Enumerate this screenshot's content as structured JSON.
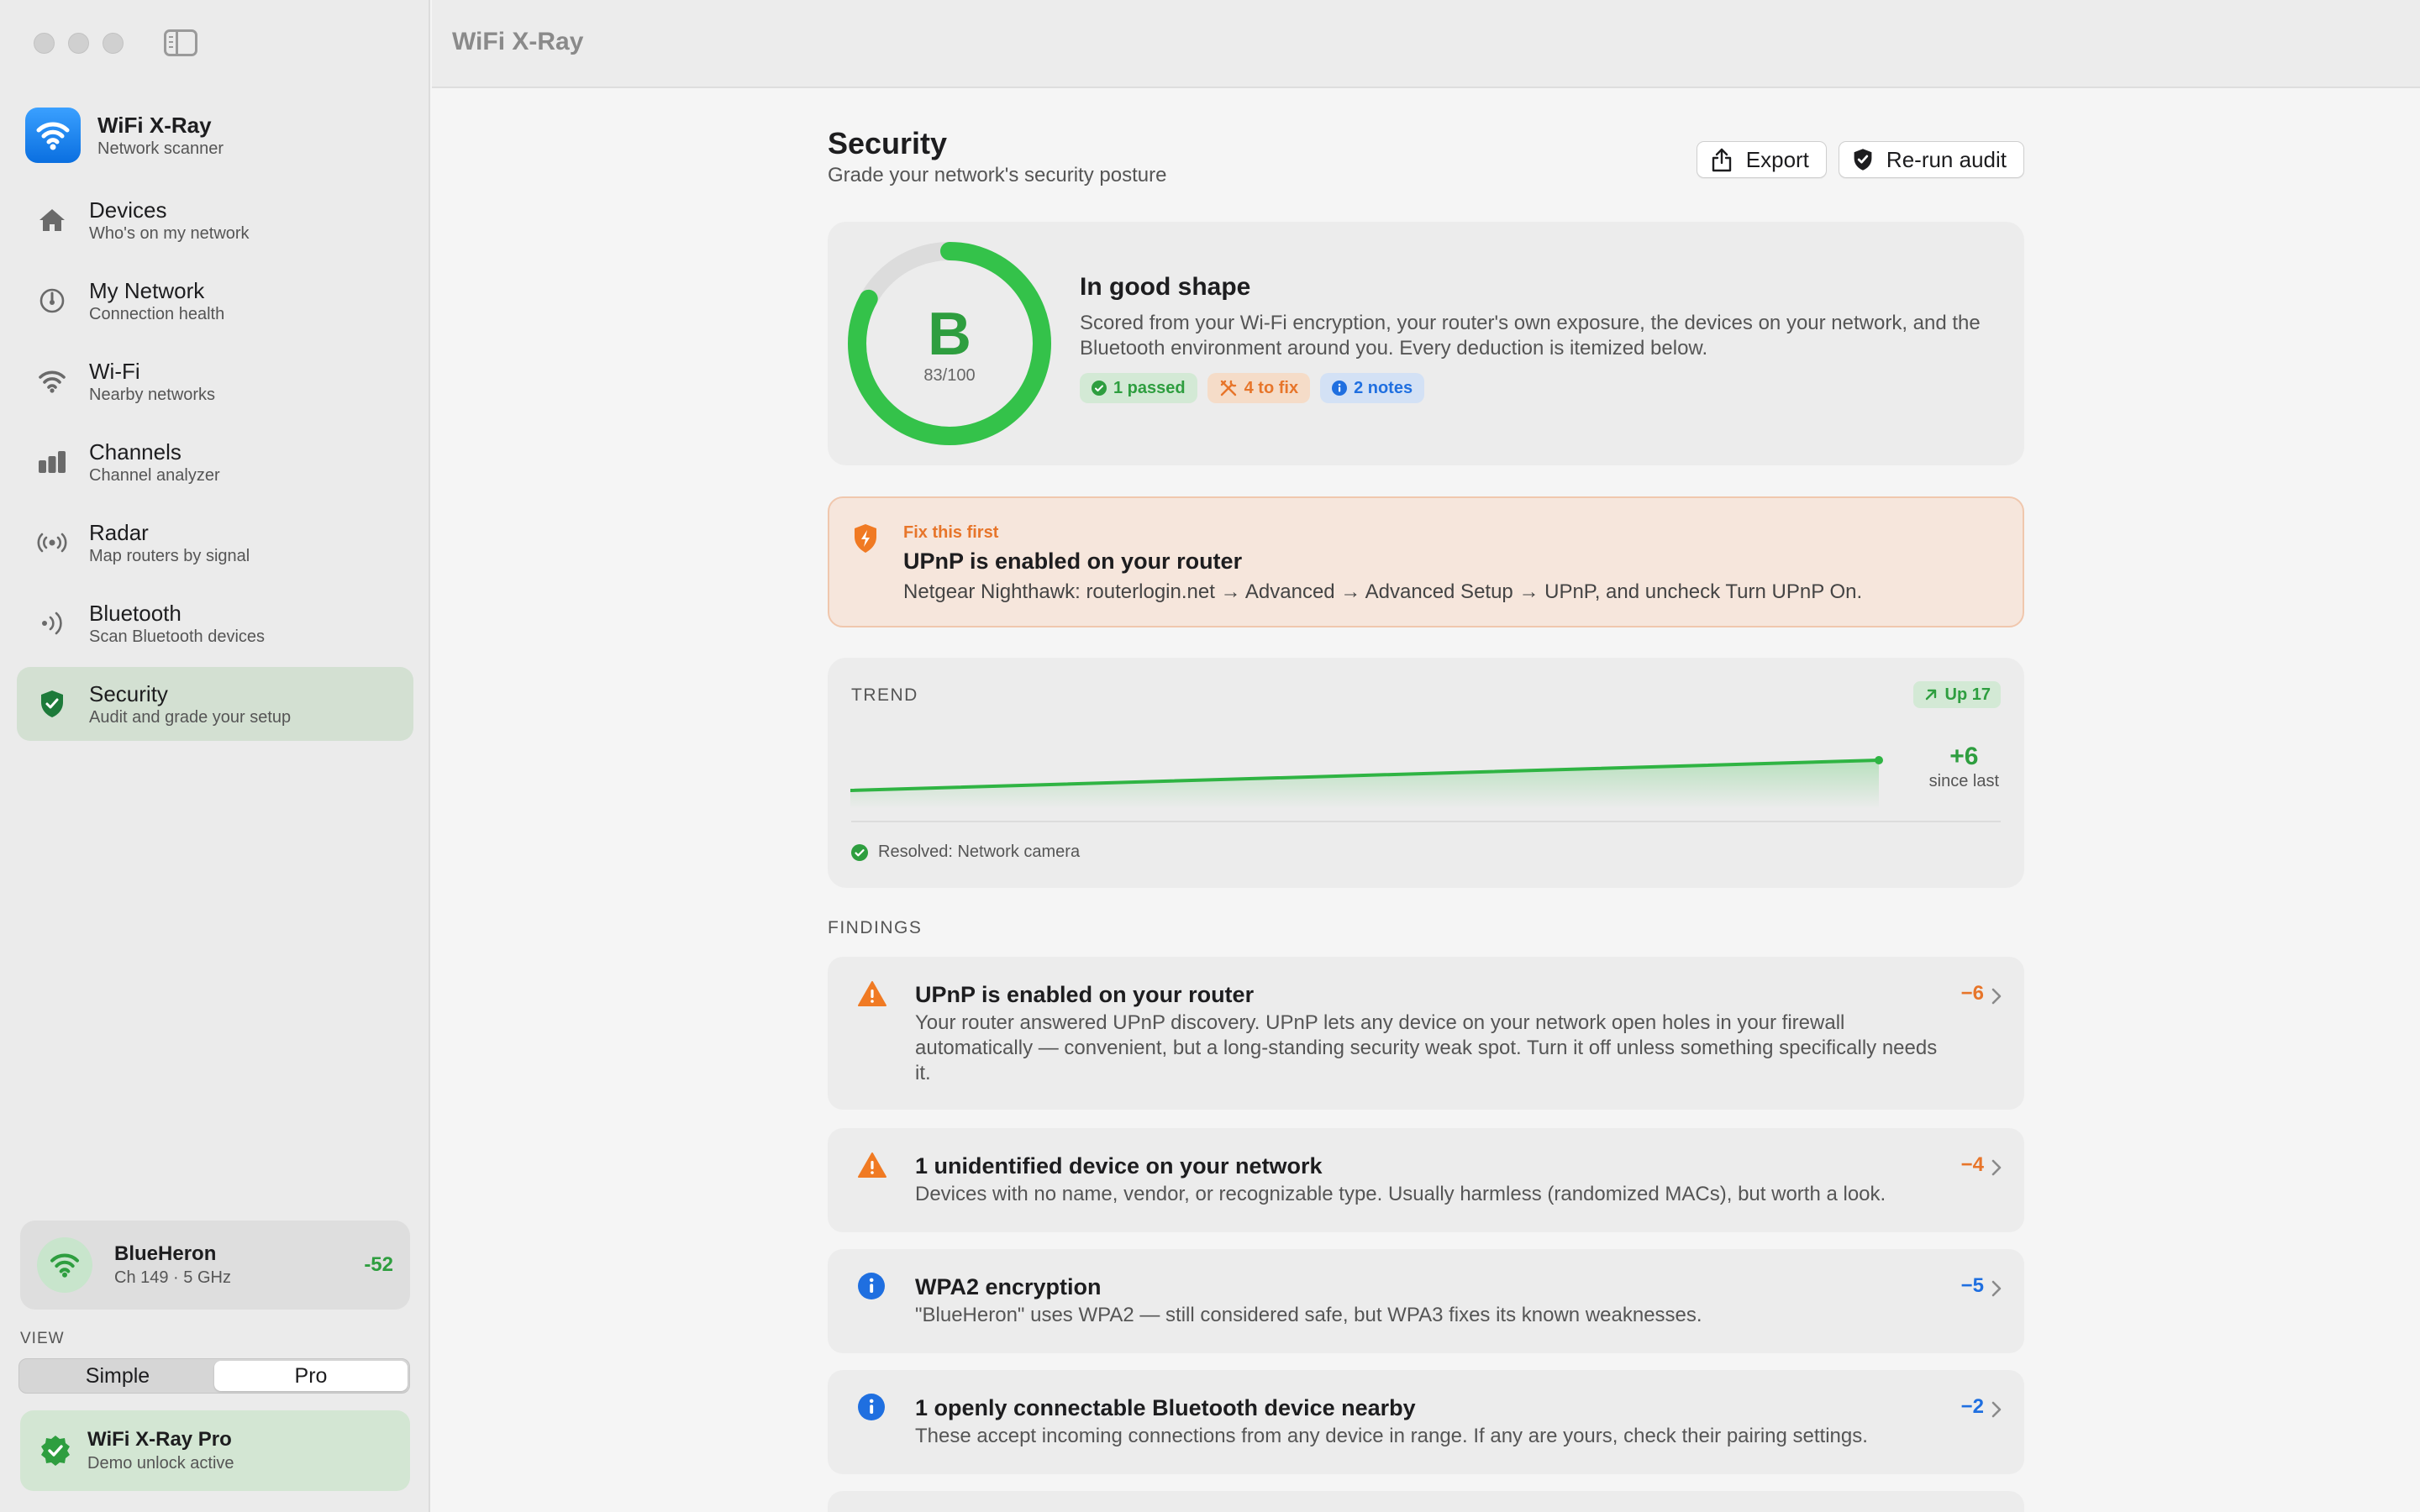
{
  "app": {
    "title": "WiFi X-Ray",
    "subtitle": "Network scanner"
  },
  "colors": {
    "accent": "#2e9e3f",
    "warning": "#e7752a",
    "info": "#1f6fe0",
    "active_nav_bg": "#d3e0d2"
  },
  "sidebar": {
    "items": [
      {
        "label": "Devices",
        "sub": "Who's on my network",
        "icon": "house-icon"
      },
      {
        "label": "My Network",
        "sub": "Connection health",
        "icon": "gauge-icon"
      },
      {
        "label": "Wi-Fi",
        "sub": "Nearby networks",
        "icon": "wifi-icon"
      },
      {
        "label": "Channels",
        "sub": "Channel analyzer",
        "icon": "bar-chart-icon"
      },
      {
        "label": "Radar",
        "sub": "Map routers by signal",
        "icon": "radar-icon"
      },
      {
        "label": "Bluetooth",
        "sub": "Scan Bluetooth devices",
        "icon": "bluetooth-waves-icon"
      },
      {
        "label": "Security",
        "sub": "Audit and grade your setup",
        "icon": "shield-check-icon",
        "active": true
      }
    ],
    "network": {
      "name": "BlueHeron",
      "details": "Ch 149 · 5 GHz",
      "rssi": "-52"
    },
    "view_label": "VIEW",
    "view_options": [
      "Simple",
      "Pro"
    ],
    "view_selected": "Pro",
    "pro": {
      "title": "WiFi X-Ray Pro",
      "sub": "Demo unlock active"
    }
  },
  "page": {
    "title": "Security",
    "subtitle": "Grade your network's security posture",
    "export_label": "Export",
    "rerun_label": "Re-run audit"
  },
  "score": {
    "grade": "B",
    "value_text": "83/100",
    "fraction": 0.83,
    "title": "In good shape",
    "description": "Scored from your Wi-Fi encryption, your router's own exposure, the devices on your network, and the Bluetooth environment around you. Every deduction is itemized below.",
    "passed": "1 passed",
    "to_fix": "4 to fix",
    "notes": "2 notes"
  },
  "fix_first": {
    "kicker": "Fix this first",
    "title": "UPnP is enabled on your router",
    "description": "Netgear Nighthawk: routerlogin.net → Advanced → Advanced Setup → UPnP, and uncheck Turn UPnP On."
  },
  "trend": {
    "label": "TREND",
    "badge": "Up 17",
    "delta": "+6",
    "delta_label": "since last",
    "resolved": "Resolved: Network camera"
  },
  "findings_label": "FINDINGS",
  "findings": [
    {
      "title": "UPnP is enabled on your router",
      "description": "Your router answered UPnP discovery. UPnP lets any device on your network open holes in your firewall automatically — convenient, but a long-standing security weak spot. Turn it off unless something specifically needs it.",
      "score": "−6",
      "severity": "warning"
    },
    {
      "title": "1 unidentified device on your network",
      "description": "Devices with no name, vendor, or recognizable type. Usually harmless (randomized MACs), but worth a look.",
      "score": "−4",
      "severity": "warning"
    },
    {
      "title": "WPA2 encryption",
      "description": "\"BlueHeron\" uses WPA2 — still considered safe, but WPA3 fixes its known weaknesses.",
      "score": "−5",
      "severity": "info"
    },
    {
      "title": "1 openly connectable Bluetooth device nearby",
      "description": "These accept incoming connections from any device in range. If any are yours, check their pairing settings.",
      "score": "−2",
      "severity": "info"
    }
  ]
}
